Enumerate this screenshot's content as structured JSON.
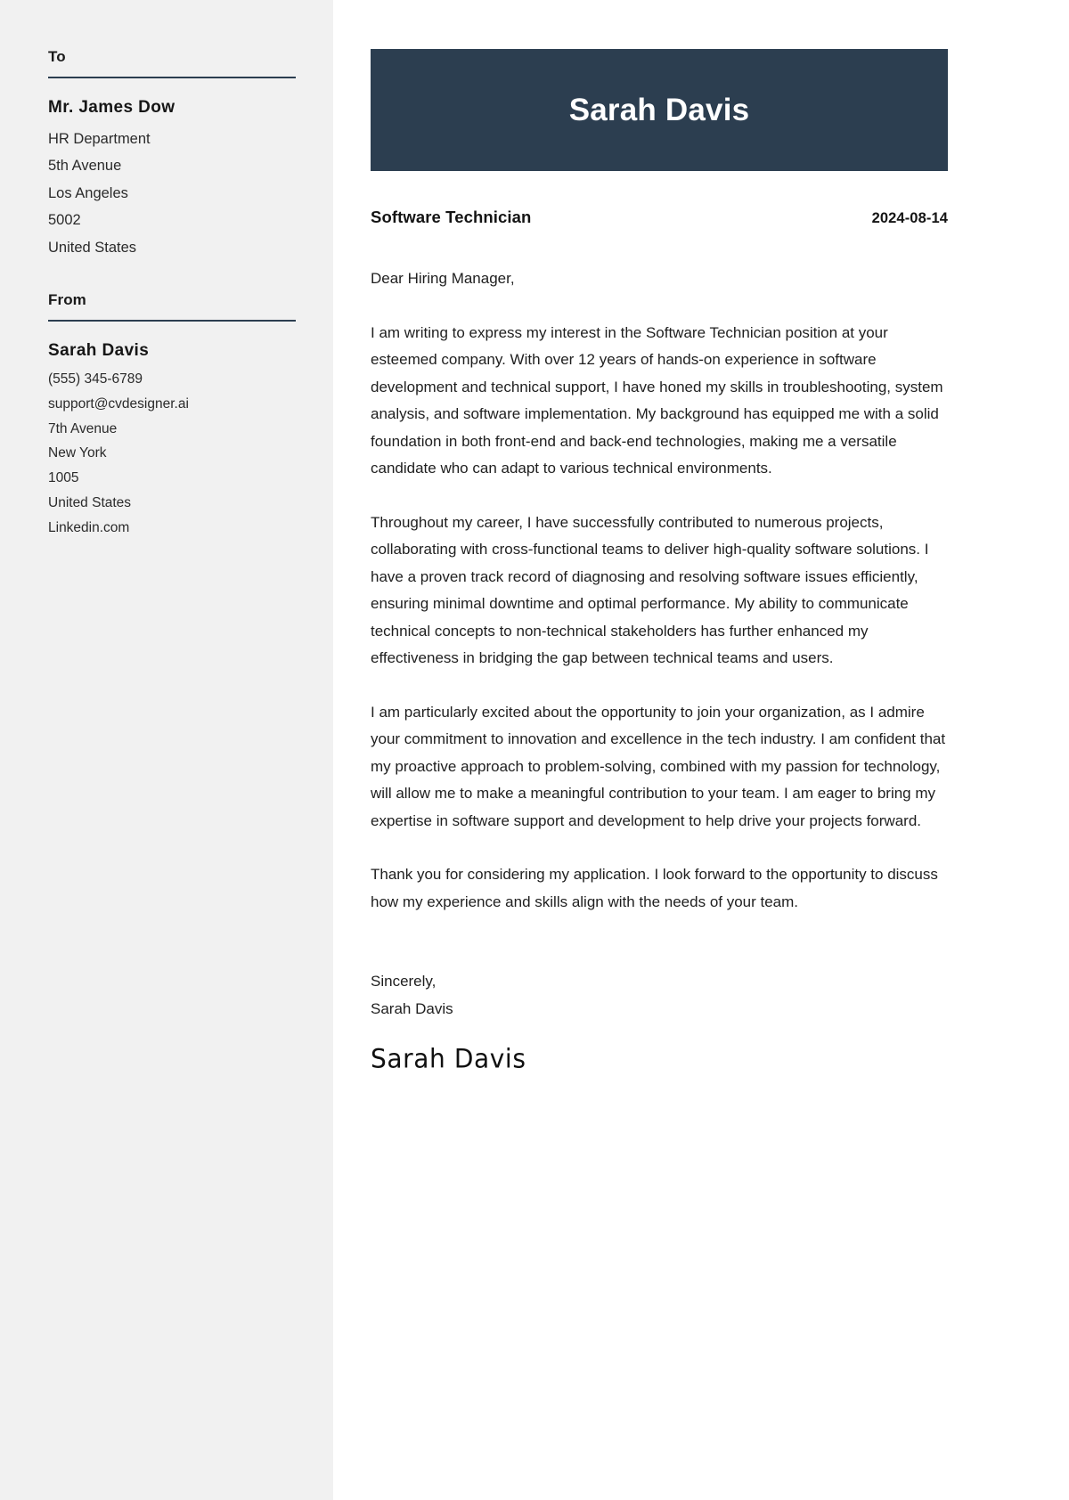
{
  "theme": {
    "sidebar_bg": "#f1f1f1",
    "accent": "#2c3e50",
    "page_bg": "#ffffff",
    "text": "#1f1f1f"
  },
  "sidebar": {
    "to": {
      "heading": "To",
      "name": "Mr. James Dow",
      "lines": [
        "HR Department",
        "5th Avenue",
        "Los Angeles",
        "5002",
        "United States"
      ]
    },
    "from": {
      "heading": "From",
      "name": "Sarah Davis",
      "lines": [
        "(555) 345-6789",
        "support@cvdesigner.ai",
        "7th Avenue",
        "New York",
        "1005",
        "United States",
        "Linkedin.com"
      ]
    }
  },
  "header": {
    "name": "Sarah Davis"
  },
  "meta": {
    "job_title": "Software Technician",
    "date": "2024-08-14"
  },
  "letter": {
    "salutation": "Dear Hiring Manager,",
    "paragraphs": [
      "I am writing to express my interest in the Software Technician position at your esteemed company. With over 12 years of hands-on experience in software development and technical support, I have honed my skills in troubleshooting, system analysis, and software implementation. My background has equipped me with a solid foundation in both front-end and back-end technologies, making me a versatile candidate who can adapt to various technical environments.",
      "Throughout my career, I have successfully contributed to numerous projects, collaborating with cross-functional teams to deliver high-quality software solutions. I have a proven track record of diagnosing and resolving software issues efficiently, ensuring minimal downtime and optimal performance. My ability to communicate technical concepts to non-technical stakeholders has further enhanced my effectiveness in bridging the gap between technical teams and users.",
      "I am particularly excited about the opportunity to join your organization, as I admire your commitment to innovation and excellence in the tech industry. I am confident that my proactive approach to problem-solving, combined with my passion for technology, will allow me to make a meaningful contribution to your team. I am eager to bring my expertise in software support and development to help drive your projects forward.",
      "Thank you for considering my application. I look forward to the opportunity to discuss how my experience and skills align with the needs of your team."
    ],
    "closing_word": "Sincerely,",
    "closing_name": "Sarah Davis",
    "signature": "Sarah Davis"
  }
}
